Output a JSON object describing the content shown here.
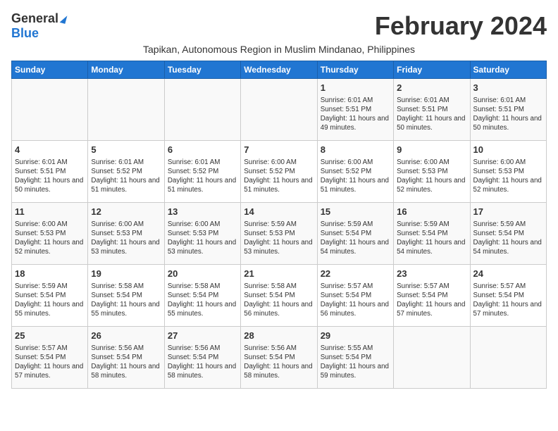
{
  "header": {
    "logo_general": "General",
    "logo_blue": "Blue",
    "month_title": "February 2024",
    "subtitle": "Tapikan, Autonomous Region in Muslim Mindanao, Philippines"
  },
  "calendar": {
    "days_of_week": [
      "Sunday",
      "Monday",
      "Tuesday",
      "Wednesday",
      "Thursday",
      "Friday",
      "Saturday"
    ],
    "weeks": [
      [
        {
          "day": "",
          "info": ""
        },
        {
          "day": "",
          "info": ""
        },
        {
          "day": "",
          "info": ""
        },
        {
          "day": "",
          "info": ""
        },
        {
          "day": "1",
          "info": "Sunrise: 6:01 AM\nSunset: 5:51 PM\nDaylight: 11 hours and 49 minutes."
        },
        {
          "day": "2",
          "info": "Sunrise: 6:01 AM\nSunset: 5:51 PM\nDaylight: 11 hours and 50 minutes."
        },
        {
          "day": "3",
          "info": "Sunrise: 6:01 AM\nSunset: 5:51 PM\nDaylight: 11 hours and 50 minutes."
        }
      ],
      [
        {
          "day": "4",
          "info": "Sunrise: 6:01 AM\nSunset: 5:51 PM\nDaylight: 11 hours and 50 minutes."
        },
        {
          "day": "5",
          "info": "Sunrise: 6:01 AM\nSunset: 5:52 PM\nDaylight: 11 hours and 51 minutes."
        },
        {
          "day": "6",
          "info": "Sunrise: 6:01 AM\nSunset: 5:52 PM\nDaylight: 11 hours and 51 minutes."
        },
        {
          "day": "7",
          "info": "Sunrise: 6:00 AM\nSunset: 5:52 PM\nDaylight: 11 hours and 51 minutes."
        },
        {
          "day": "8",
          "info": "Sunrise: 6:00 AM\nSunset: 5:52 PM\nDaylight: 11 hours and 51 minutes."
        },
        {
          "day": "9",
          "info": "Sunrise: 6:00 AM\nSunset: 5:53 PM\nDaylight: 11 hours and 52 minutes."
        },
        {
          "day": "10",
          "info": "Sunrise: 6:00 AM\nSunset: 5:53 PM\nDaylight: 11 hours and 52 minutes."
        }
      ],
      [
        {
          "day": "11",
          "info": "Sunrise: 6:00 AM\nSunset: 5:53 PM\nDaylight: 11 hours and 52 minutes."
        },
        {
          "day": "12",
          "info": "Sunrise: 6:00 AM\nSunset: 5:53 PM\nDaylight: 11 hours and 53 minutes."
        },
        {
          "day": "13",
          "info": "Sunrise: 6:00 AM\nSunset: 5:53 PM\nDaylight: 11 hours and 53 minutes."
        },
        {
          "day": "14",
          "info": "Sunrise: 5:59 AM\nSunset: 5:53 PM\nDaylight: 11 hours and 53 minutes."
        },
        {
          "day": "15",
          "info": "Sunrise: 5:59 AM\nSunset: 5:54 PM\nDaylight: 11 hours and 54 minutes."
        },
        {
          "day": "16",
          "info": "Sunrise: 5:59 AM\nSunset: 5:54 PM\nDaylight: 11 hours and 54 minutes."
        },
        {
          "day": "17",
          "info": "Sunrise: 5:59 AM\nSunset: 5:54 PM\nDaylight: 11 hours and 54 minutes."
        }
      ],
      [
        {
          "day": "18",
          "info": "Sunrise: 5:59 AM\nSunset: 5:54 PM\nDaylight: 11 hours and 55 minutes."
        },
        {
          "day": "19",
          "info": "Sunrise: 5:58 AM\nSunset: 5:54 PM\nDaylight: 11 hours and 55 minutes."
        },
        {
          "day": "20",
          "info": "Sunrise: 5:58 AM\nSunset: 5:54 PM\nDaylight: 11 hours and 55 minutes."
        },
        {
          "day": "21",
          "info": "Sunrise: 5:58 AM\nSunset: 5:54 PM\nDaylight: 11 hours and 56 minutes."
        },
        {
          "day": "22",
          "info": "Sunrise: 5:57 AM\nSunset: 5:54 PM\nDaylight: 11 hours and 56 minutes."
        },
        {
          "day": "23",
          "info": "Sunrise: 5:57 AM\nSunset: 5:54 PM\nDaylight: 11 hours and 57 minutes."
        },
        {
          "day": "24",
          "info": "Sunrise: 5:57 AM\nSunset: 5:54 PM\nDaylight: 11 hours and 57 minutes."
        }
      ],
      [
        {
          "day": "25",
          "info": "Sunrise: 5:57 AM\nSunset: 5:54 PM\nDaylight: 11 hours and 57 minutes."
        },
        {
          "day": "26",
          "info": "Sunrise: 5:56 AM\nSunset: 5:54 PM\nDaylight: 11 hours and 58 minutes."
        },
        {
          "day": "27",
          "info": "Sunrise: 5:56 AM\nSunset: 5:54 PM\nDaylight: 11 hours and 58 minutes."
        },
        {
          "day": "28",
          "info": "Sunrise: 5:56 AM\nSunset: 5:54 PM\nDaylight: 11 hours and 58 minutes."
        },
        {
          "day": "29",
          "info": "Sunrise: 5:55 AM\nSunset: 5:54 PM\nDaylight: 11 hours and 59 minutes."
        },
        {
          "day": "",
          "info": ""
        },
        {
          "day": "",
          "info": ""
        }
      ]
    ]
  }
}
